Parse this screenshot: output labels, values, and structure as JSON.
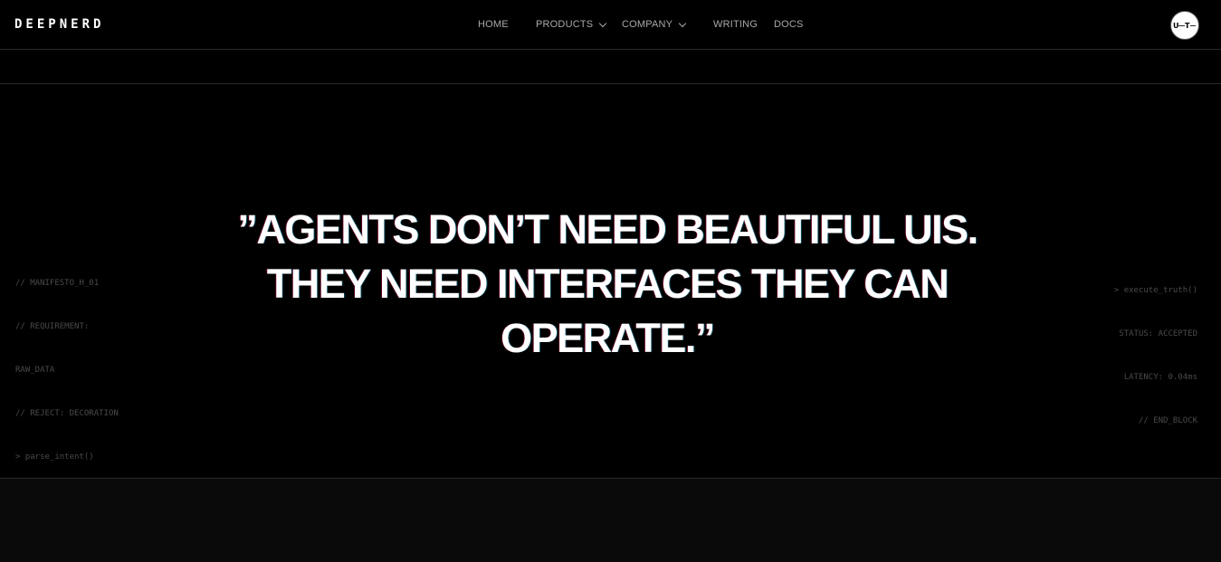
{
  "header": {
    "brand": "DEEPNERD",
    "nav": {
      "home": "HOME",
      "products": "PRODUCTS",
      "company": "COMPANY",
      "writing": "WRITING",
      "docs": "DOCS"
    },
    "avatar_icon": "user-avatar-icon"
  },
  "hero": {
    "code_left": [
      "// MANIFESTO_H_01",
      "// REQUIREMENT:",
      "RAW_DATA",
      "// REJECT: DECORATION",
      "> parse_intent()"
    ],
    "quote_lines": [
      "”AGENTS DON’T NEED BEAUTIFUL UIS.",
      "THEY NEED INTERFACES THEY CAN",
      "OPERATE.”"
    ],
    "code_right": [
      "> execute_truth()",
      "STATUS: ACCEPTED",
      "LATENCY: 0.04ms",
      "// END_BLOCK"
    ]
  },
  "colors": {
    "background": "#000000",
    "text": "#ffffff",
    "nav_text": "#a8a8a8",
    "code_text": "#4a4a4a",
    "divider": "#2a2a2a"
  }
}
